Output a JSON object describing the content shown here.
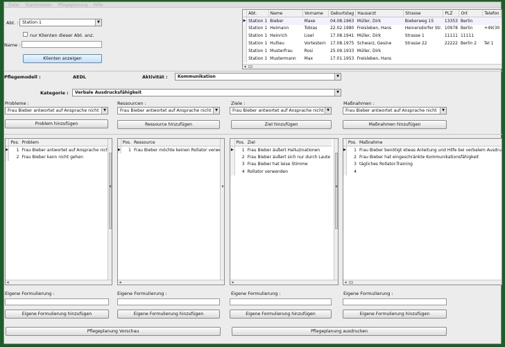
{
  "menu": [
    "Datei",
    "Stammdaten",
    "Pflegeplanung",
    "Hilfe"
  ],
  "filter": {
    "abt_label": "Abt. :",
    "abt_value": "Station 1",
    "only_dept_label": "nur Klienten dieser Abt. anz.",
    "name_label": "Name :",
    "name_value": "",
    "show_button": "Klienten anzeigen"
  },
  "clients": {
    "columns": [
      "Abt.",
      "Name",
      "Vorname",
      "Geburtstag",
      "Hausarzt",
      "Strasse",
      "PLZ",
      "Ort",
      "Telefon"
    ],
    "rows": [
      [
        "Station 1",
        "Bieber",
        "Maxe",
        "04.08.1963",
        "Müller, Dirk",
        "Bieberweg 15",
        "13353",
        "Berlin",
        ""
      ],
      [
        "Station 1",
        "Heimann",
        "Tobias",
        "22.02.1980",
        "Freisleben, Hans",
        "Heinersdorfer Str.",
        "10978",
        "Berlin",
        "+49(30"
      ],
      [
        "Station 1",
        "Heinrich",
        "Lisel",
        "17.08.1941",
        "Müller, Dirk",
        "Strasse 1",
        "11111",
        "11111",
        ""
      ],
      [
        "Station 1",
        "Hullieu",
        "Vortestern",
        "17.08.1975",
        "Schwarz, Gesine",
        "Strasse 22",
        "22222",
        "Berlin 2",
        "Tel 1"
      ],
      [
        "Station 1",
        "Musterfrau",
        "Rosi",
        "25.09.1933",
        "Müller, Dirk",
        "",
        "",
        "",
        ""
      ],
      [
        "Station 1",
        "Mustermann",
        "Max",
        "17.01.1953",
        "Freisleben, Hans",
        "",
        "",
        "",
        ""
      ]
    ]
  },
  "model": {
    "label": "Pflegemodell :",
    "value": "AEDL",
    "activity_label": "Aktivität :",
    "activity_value": "Kommunikation",
    "category_label": "Kategorie :",
    "category_value": "Verbale Ausdrucksfähigkeit"
  },
  "columns": [
    {
      "section_label": "Probleme :",
      "select_value": "Frau Bieber antwortet auf Ansprache nicht",
      "add_button": "Problem hinzufügen",
      "list_header": [
        "Pos.",
        "Problem"
      ],
      "items": [
        [
          "1",
          "Frau Bieber antwortet auf Ansprache nicht"
        ],
        [
          "2",
          "Frau Bieber kann nicht gehen"
        ]
      ],
      "own_label": "Eigene Formulierung :",
      "own_button": "Eigene Formulierung hinzufügen"
    },
    {
      "section_label": "Ressourcen :",
      "select_value": "Frau Bieber antwortet auf Ansprache nicht",
      "add_button": "Ressource hinzufügen",
      "list_header": [
        "Pos.",
        "Ressource"
      ],
      "items": [
        [
          "1",
          "Frau Bieber möchte keinen Rollator verwenden"
        ]
      ],
      "own_label": "Eigene Formulierung :",
      "own_button": "Eigene Formulierung hinzufügen"
    },
    {
      "section_label": "Ziele :",
      "select_value": "Frau Bieber antwortet auf Ansprache nicht",
      "add_button": "Ziel hinzufügen",
      "list_header": [
        "Pos.",
        "Ziel"
      ],
      "items": [
        [
          "1",
          "Frau Bieber  äußert Halluzinationen"
        ],
        [
          "2",
          "Frau Bieber  äußert sich nur durch Laute"
        ],
        [
          "3",
          "Frau Bieber  hat leise Stimme"
        ],
        [
          "4",
          "Rollator verwenden"
        ]
      ],
      "own_label": "Eigene Formulierung :",
      "own_button": "Eigene Formulierung hinzufügen"
    },
    {
      "section_label": "Maßnahmen :",
      "select_value": "Frau Bieber antwortet auf Ansprache nicht",
      "add_button": "Maßnahmen hinzufügen",
      "list_header": [
        "Pos.",
        "Maßnahme"
      ],
      "items": [
        [
          "1",
          "Frau Bieber  benötigt etwas Anleitung und Hilfe bei verbalem Ausdruck"
        ],
        [
          "2",
          "Frau Bieber  hat eingeschränkte Kommunikationsfähigkeit"
        ],
        [
          "3",
          "tägliches Rollator-Training"
        ],
        [
          "4",
          ""
        ]
      ],
      "own_label": "Eigene Formulierung :",
      "own_button": "Eigene Formulierung hinzufügen"
    }
  ],
  "footer": {
    "preview_button": "Pflegeplanung Vorschau",
    "print_button": "Pflegeplanung ausdrucken"
  },
  "colors": {
    "frame": "#1e5c2a",
    "window": "#ececec",
    "accent": "#4d8fc8"
  }
}
